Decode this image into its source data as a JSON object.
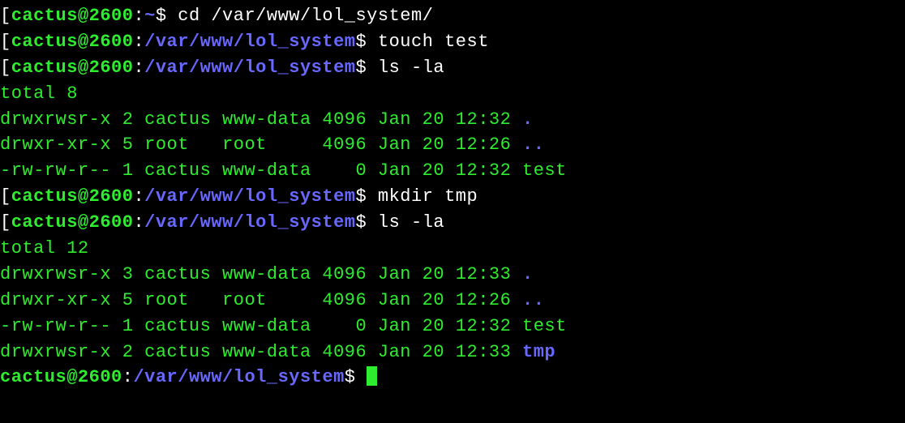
{
  "prompts": [
    {
      "bracket_open": "[",
      "userhost": "cactus@2600",
      "colon": ":",
      "path": "~",
      "dollar": "$ ",
      "cmd": "cd /var/www/lol_system/"
    },
    {
      "bracket_open": "[",
      "userhost": "cactus@2600",
      "colon": ":",
      "path": "/var/www/lol_system",
      "dollar": "$ ",
      "cmd": "touch test"
    },
    {
      "bracket_open": "[",
      "userhost": "cactus@2600",
      "colon": ":",
      "path": "/var/www/lol_system",
      "dollar": "$ ",
      "cmd": "ls -la"
    },
    {
      "bracket_open": "[",
      "userhost": "cactus@2600",
      "colon": ":",
      "path": "/var/www/lol_system",
      "dollar": "$ ",
      "cmd": "mkdir tmp"
    },
    {
      "bracket_open": "[",
      "userhost": "cactus@2600",
      "colon": ":",
      "path": "/var/www/lol_system",
      "dollar": "$ ",
      "cmd": "ls -la"
    },
    {
      "bracket_open": "",
      "userhost": "cactus@2600",
      "colon": ":",
      "path": "/var/www/lol_system",
      "dollar": "$ ",
      "cmd": ""
    }
  ],
  "ls1": {
    "total": "total 8",
    "rows": [
      {
        "main": "drwxrwsr-x 2 cactus www-data 4096 Jan 20 12:32 ",
        "name": ".",
        "dir": true
      },
      {
        "main": "drwxr-xr-x 5 root   root     4096 Jan 20 12:26 ",
        "name": "..",
        "dir": true
      },
      {
        "main": "-rw-rw-r-- 1 cactus www-data    0 Jan 20 12:32 ",
        "name": "test",
        "dir": false
      }
    ]
  },
  "ls2": {
    "total": "total 12",
    "rows": [
      {
        "main": "drwxrwsr-x 3 cactus www-data 4096 Jan 20 12:33 ",
        "name": ".",
        "dir": true
      },
      {
        "main": "drwxr-xr-x 5 root   root     4096 Jan 20 12:26 ",
        "name": "..",
        "dir": true
      },
      {
        "main": "-rw-rw-r-- 1 cactus www-data    0 Jan 20 12:32 ",
        "name": "test",
        "dir": false
      },
      {
        "main": "drwxrwsr-x 2 cactus www-data 4096 Jan 20 12:33 ",
        "name": "tmp",
        "dir": true
      }
    ]
  }
}
